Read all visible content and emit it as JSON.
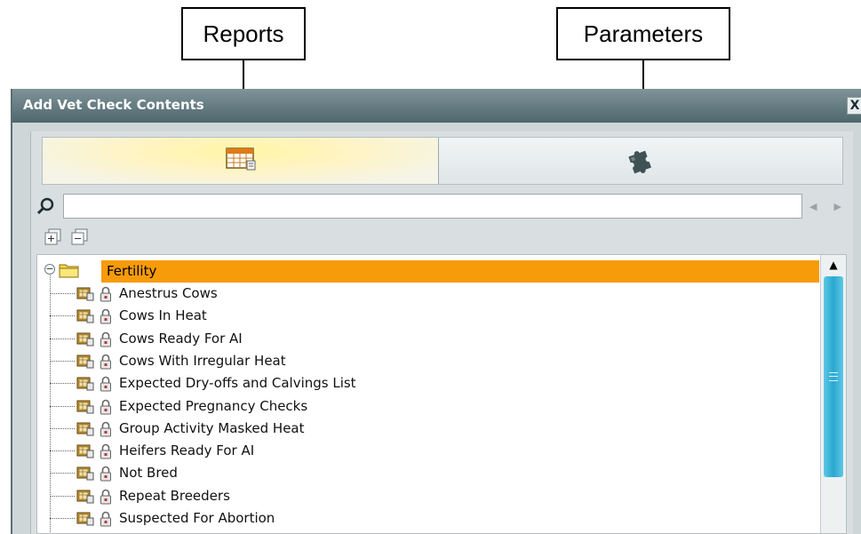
{
  "callouts": {
    "reports": "Reports",
    "parameters": "Parameters"
  },
  "window": {
    "title": "Add Vet Check Contents",
    "close_label": "X"
  },
  "search": {
    "value": "",
    "placeholder": ""
  },
  "tree": {
    "root_label": "Fertility",
    "items": [
      {
        "label": "Anestrus Cows"
      },
      {
        "label": "Cows In Heat"
      },
      {
        "label": "Cows Ready For AI"
      },
      {
        "label": "Cows With Irregular Heat"
      },
      {
        "label": "Expected Dry-offs and Calvings List"
      },
      {
        "label": "Expected Pregnancy Checks"
      },
      {
        "label": "Group Activity Masked Heat"
      },
      {
        "label": "Heifers Ready For AI"
      },
      {
        "label": "Not Bred"
      },
      {
        "label": "Repeat Breeders"
      },
      {
        "label": "Suspected For Abortion"
      }
    ]
  },
  "icons": {
    "reports_tab": "table-report-icon",
    "parameters_tab": "puzzle-piece-icon",
    "search": "search-icon",
    "expand_all": "expand-all-icon",
    "collapse_all": "collapse-all-icon",
    "folder": "folder-icon",
    "report": "report-book-icon",
    "lock": "lock-icon"
  },
  "colors": {
    "title_bar": "#5f767c",
    "selected_row": "#f79b0a",
    "active_tab": "#fff4c4",
    "scroll_thumb": "#2aa7cf"
  }
}
